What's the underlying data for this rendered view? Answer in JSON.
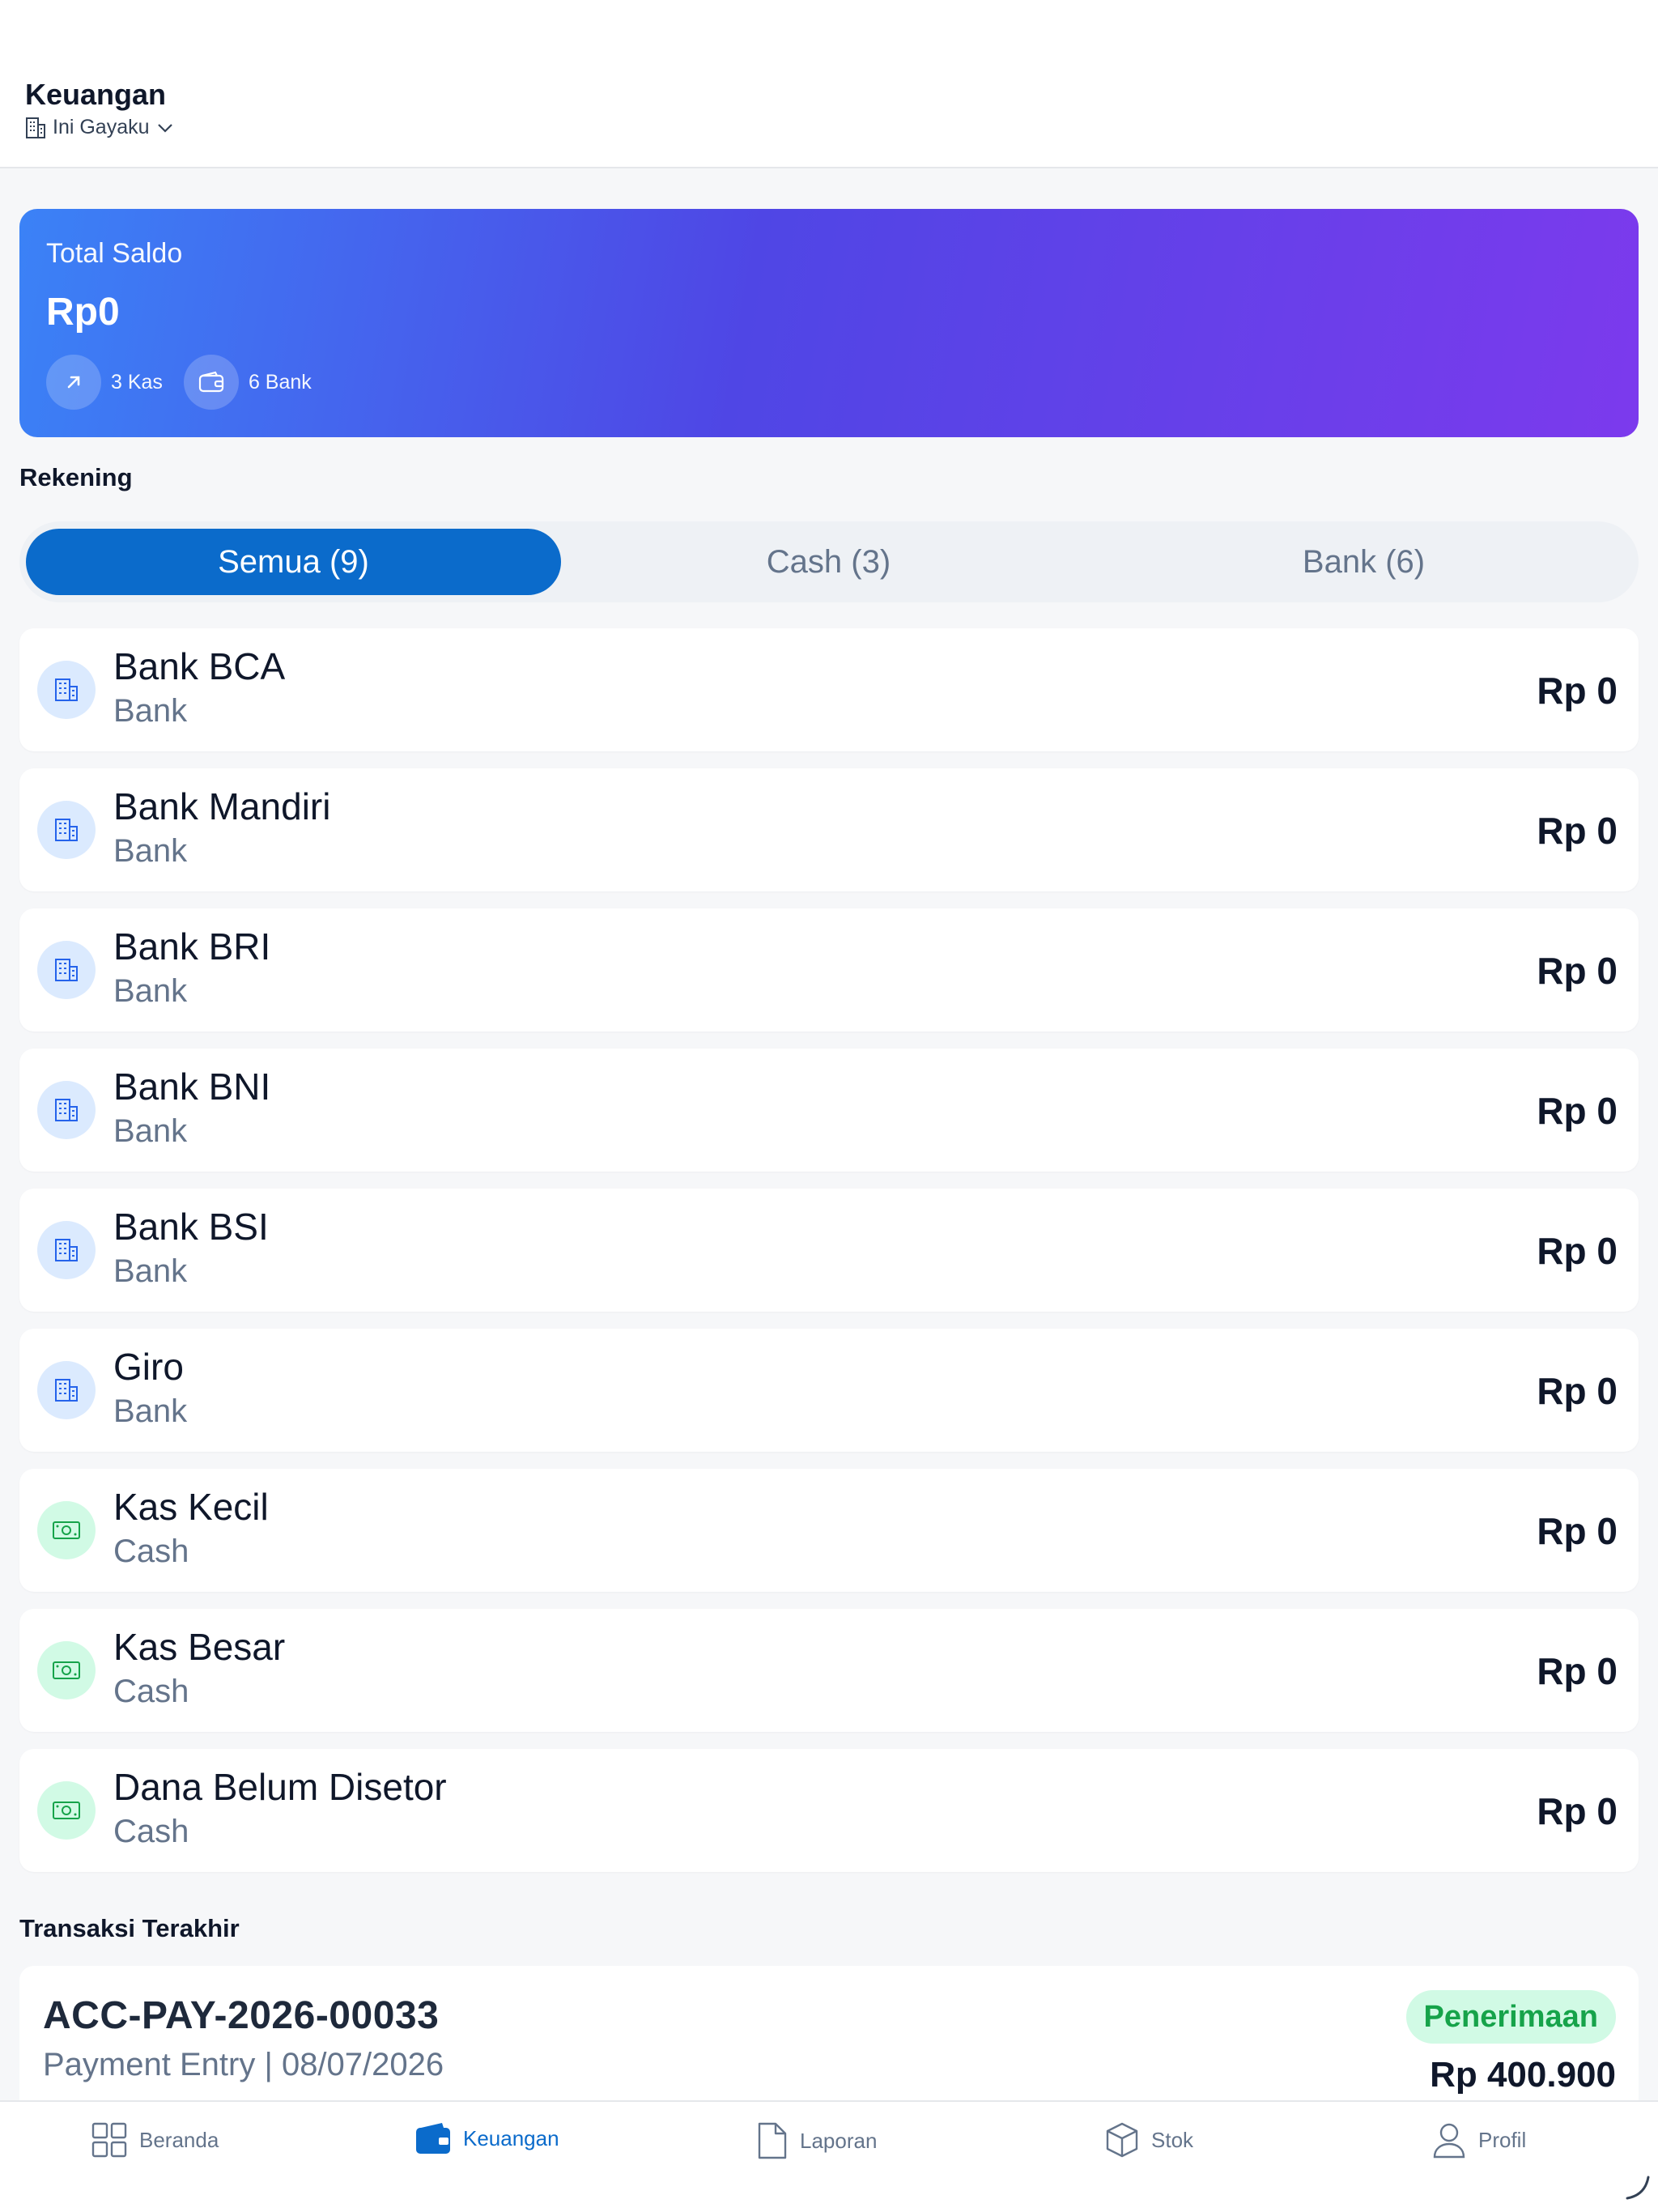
{
  "header": {
    "title": "Keuangan",
    "org_name": "Ini Gayaku"
  },
  "summary": {
    "label": "Total Saldo",
    "amount": "Rp0",
    "kas_count": "3 Kas",
    "bank_count": "6 Bank"
  },
  "accounts_section": {
    "title": "Rekening",
    "tabs": [
      {
        "label": "Semua (9)",
        "active": true
      },
      {
        "label": "Cash (3)",
        "active": false
      },
      {
        "label": "Bank (6)",
        "active": false
      }
    ],
    "items": [
      {
        "name": "Bank BCA",
        "type": "Bank",
        "balance": "Rp 0",
        "icon": "building-icon"
      },
      {
        "name": "Bank Mandiri",
        "type": "Bank",
        "balance": "Rp 0",
        "icon": "building-icon"
      },
      {
        "name": "Bank BRI",
        "type": "Bank",
        "balance": "Rp 0",
        "icon": "building-icon"
      },
      {
        "name": "Bank BNI",
        "type": "Bank",
        "balance": "Rp 0",
        "icon": "building-icon"
      },
      {
        "name": "Bank BSI",
        "type": "Bank",
        "balance": "Rp 0",
        "icon": "building-icon"
      },
      {
        "name": "Giro",
        "type": "Bank",
        "balance": "Rp 0",
        "icon": "building-icon"
      },
      {
        "name": "Kas Kecil",
        "type": "Cash",
        "balance": "Rp 0",
        "icon": "banknote-icon"
      },
      {
        "name": "Kas Besar",
        "type": "Cash",
        "balance": "Rp 0",
        "icon": "banknote-icon"
      },
      {
        "name": "Dana Belum Disetor",
        "type": "Cash",
        "balance": "Rp 0",
        "icon": "banknote-icon"
      }
    ]
  },
  "transactions_section": {
    "title": "Transaksi Terakhir",
    "latest": {
      "reference": "ACC-PAY-2026-00033",
      "meta": "Payment Entry | 08/07/2026",
      "badge": "Penerimaan",
      "amount": "Rp 400.900"
    }
  },
  "bottom_nav": [
    {
      "label": "Beranda",
      "icon": "grid-icon",
      "active": false
    },
    {
      "label": "Keuangan",
      "icon": "wallet-icon",
      "active": true
    },
    {
      "label": "Laporan",
      "icon": "document-icon",
      "active": false
    },
    {
      "label": "Stok",
      "icon": "box-icon",
      "active": false
    },
    {
      "label": "Profil",
      "icon": "user-icon",
      "active": false
    }
  ],
  "colors": {
    "primary": "#0b6bcb",
    "gradient_start": "#3b82f6",
    "gradient_mid": "#4f46e5",
    "gradient_end": "#7c3aed",
    "success": "#16a34a",
    "success_bg": "#d1fae5"
  }
}
